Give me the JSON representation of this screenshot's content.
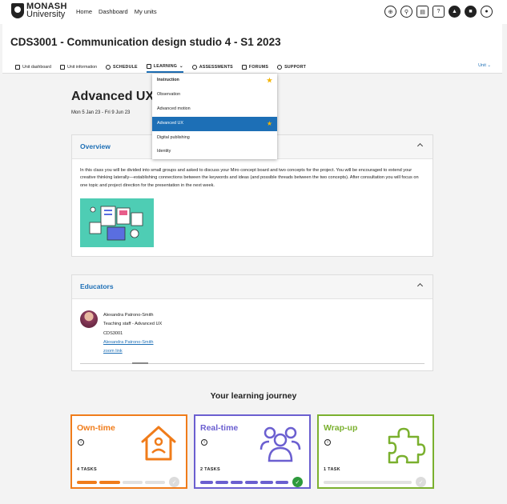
{
  "topbar": {
    "logo_line1": "MONASH",
    "logo_line2": "University",
    "nav": [
      "Home",
      "Dashboard",
      "My units"
    ]
  },
  "unit": {
    "title": "CDS3001 - Communication design studio 4 - S1 2023",
    "tabs": [
      {
        "label": "Unit dashboard"
      },
      {
        "label": "Unit information"
      },
      {
        "label": "SCHEDULE"
      },
      {
        "label": "LEARNING"
      },
      {
        "label": "ASSESSMENTS"
      },
      {
        "label": "FORUMS"
      },
      {
        "label": "SUPPORT"
      }
    ],
    "unit_menu": "Unit"
  },
  "dropdown": {
    "items": [
      {
        "label": "Instruction",
        "starred": true
      },
      {
        "label": "Observation"
      },
      {
        "label": "Advanced motion"
      },
      {
        "label": "Advanced UX",
        "starred": true,
        "selected": true
      },
      {
        "label": "Digital publishing"
      },
      {
        "label": "Identity"
      }
    ]
  },
  "content": {
    "title": "Advanced UX",
    "dates": "Mon 5 Jan 23 - Fri 9 Jun 23"
  },
  "overview": {
    "heading": "Overview",
    "text": "In this class you will be divided into small groups and asked to discuss your Miro concept board and two concepts for the project. You will be encouraged to extend your creative thinking laterally—establishing connections between the keywords and ideas (and possible threads between the two concepts). After consultation you will focus on one topic and project direction for the presentation in the next week."
  },
  "educators": {
    "heading": "Educators",
    "name": "Alexandra Patrono-Smith",
    "role": "Teaching staff - Advanced UX",
    "unit": "CDS3001",
    "email_link": "Alexandra Patrono-Smith",
    "zoom_link": "zoom link"
  },
  "journey": {
    "title": "Your learning journey",
    "cards": [
      {
        "title": "Own-time",
        "tasks": "4 TASKS",
        "color": "#f07c1a",
        "done": 2,
        "total": 4,
        "complete": false
      },
      {
        "title": "Real-time",
        "tasks": "2 TASKS",
        "color": "#6b5fd0",
        "done": 6,
        "total": 6,
        "complete": true
      },
      {
        "title": "Wrap-up",
        "tasks": "1 TASK",
        "color": "#7ab02e",
        "done": 0,
        "total": 1,
        "complete": false
      }
    ]
  }
}
